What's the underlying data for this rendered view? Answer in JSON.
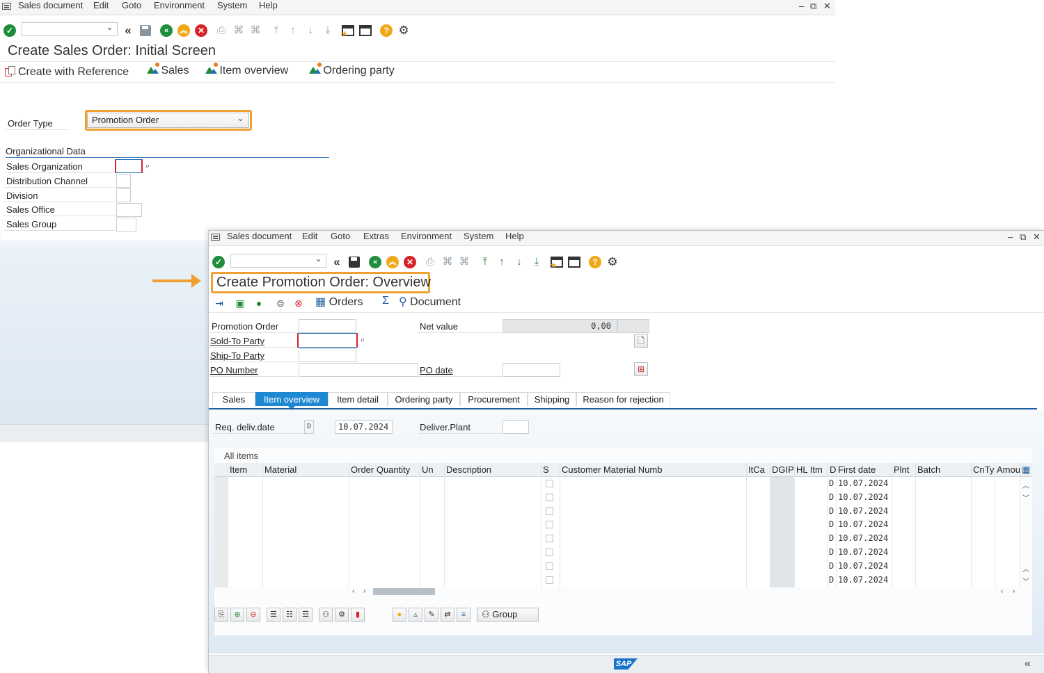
{
  "bg_window": {
    "menu": [
      "Sales document",
      "Edit",
      "Goto",
      "Environment",
      "System",
      "Help"
    ],
    "window_controls": [
      "–",
      "⧉",
      "✕"
    ],
    "title": "Create Sales Order: Initial Screen",
    "app_toolbar": {
      "create_with_reference": "Create with Reference",
      "sales": "Sales",
      "item_overview": "Item overview",
      "ordering_party": "Ordering party"
    },
    "order_type_label": "Order Type",
    "order_type_value": "Promotion Order",
    "org_group_title": "Organizational Data",
    "org_fields": [
      "Sales Organization",
      "Distribution Channel",
      "Division",
      "Sales Office",
      "Sales Group"
    ]
  },
  "fg_window": {
    "menu": [
      "Sales document",
      "Edit",
      "Goto",
      "Extras",
      "Environment",
      "System",
      "Help"
    ],
    "window_controls": [
      "–",
      "⧉",
      "✕"
    ],
    "title": "Create Promotion Order: Overview",
    "app_toolbar": {
      "orders": "Orders",
      "sigma": "Σ",
      "document": "Document"
    },
    "header_fields": {
      "promotion_order": "Promotion Order",
      "sold_to_party": "Sold-To Party",
      "ship_to_party": "Ship-To Party",
      "po_number": "PO Number",
      "net_value_label": "Net value",
      "net_value": "0,00",
      "po_date_label": "PO date"
    },
    "tabs": [
      "Sales",
      "Item overview",
      "Item detail",
      "Ordering party",
      "Procurement",
      "Shipping",
      "Reason for rejection"
    ],
    "active_tab": "Item overview",
    "req_deliv_label": "Req. deliv.date",
    "req_deliv_period": "D",
    "req_deliv_date": "10.07.2024",
    "deliver_plant_label": "Deliver.Plant",
    "table": {
      "caption": "All items",
      "columns": [
        "Item",
        "Material",
        "Order Quantity",
        "Un",
        "Description",
        "S",
        "Customer Material Numb",
        "ItCa",
        "DGIP",
        "HL Itm",
        "D",
        "First date",
        "Plnt",
        "Batch",
        "CnTy",
        "Amou"
      ],
      "rows": [
        {
          "d": "D",
          "first_date": "10.07.2024"
        },
        {
          "d": "D",
          "first_date": "10.07.2024"
        },
        {
          "d": "D",
          "first_date": "10.07.2024"
        },
        {
          "d": "D",
          "first_date": "10.07.2024"
        },
        {
          "d": "D",
          "first_date": "10.07.2024"
        },
        {
          "d": "D",
          "first_date": "10.07.2024"
        },
        {
          "d": "D",
          "first_date": "10.07.2024"
        },
        {
          "d": "D",
          "first_date": "10.07.2024"
        }
      ]
    },
    "group_button": "Group",
    "status_logo": "SAP"
  },
  "colors": {
    "highlight": "#f0a030",
    "active_tab": "#1e88d2",
    "ok_green": "#1e8c3a",
    "cancel_red": "#d8232a"
  }
}
